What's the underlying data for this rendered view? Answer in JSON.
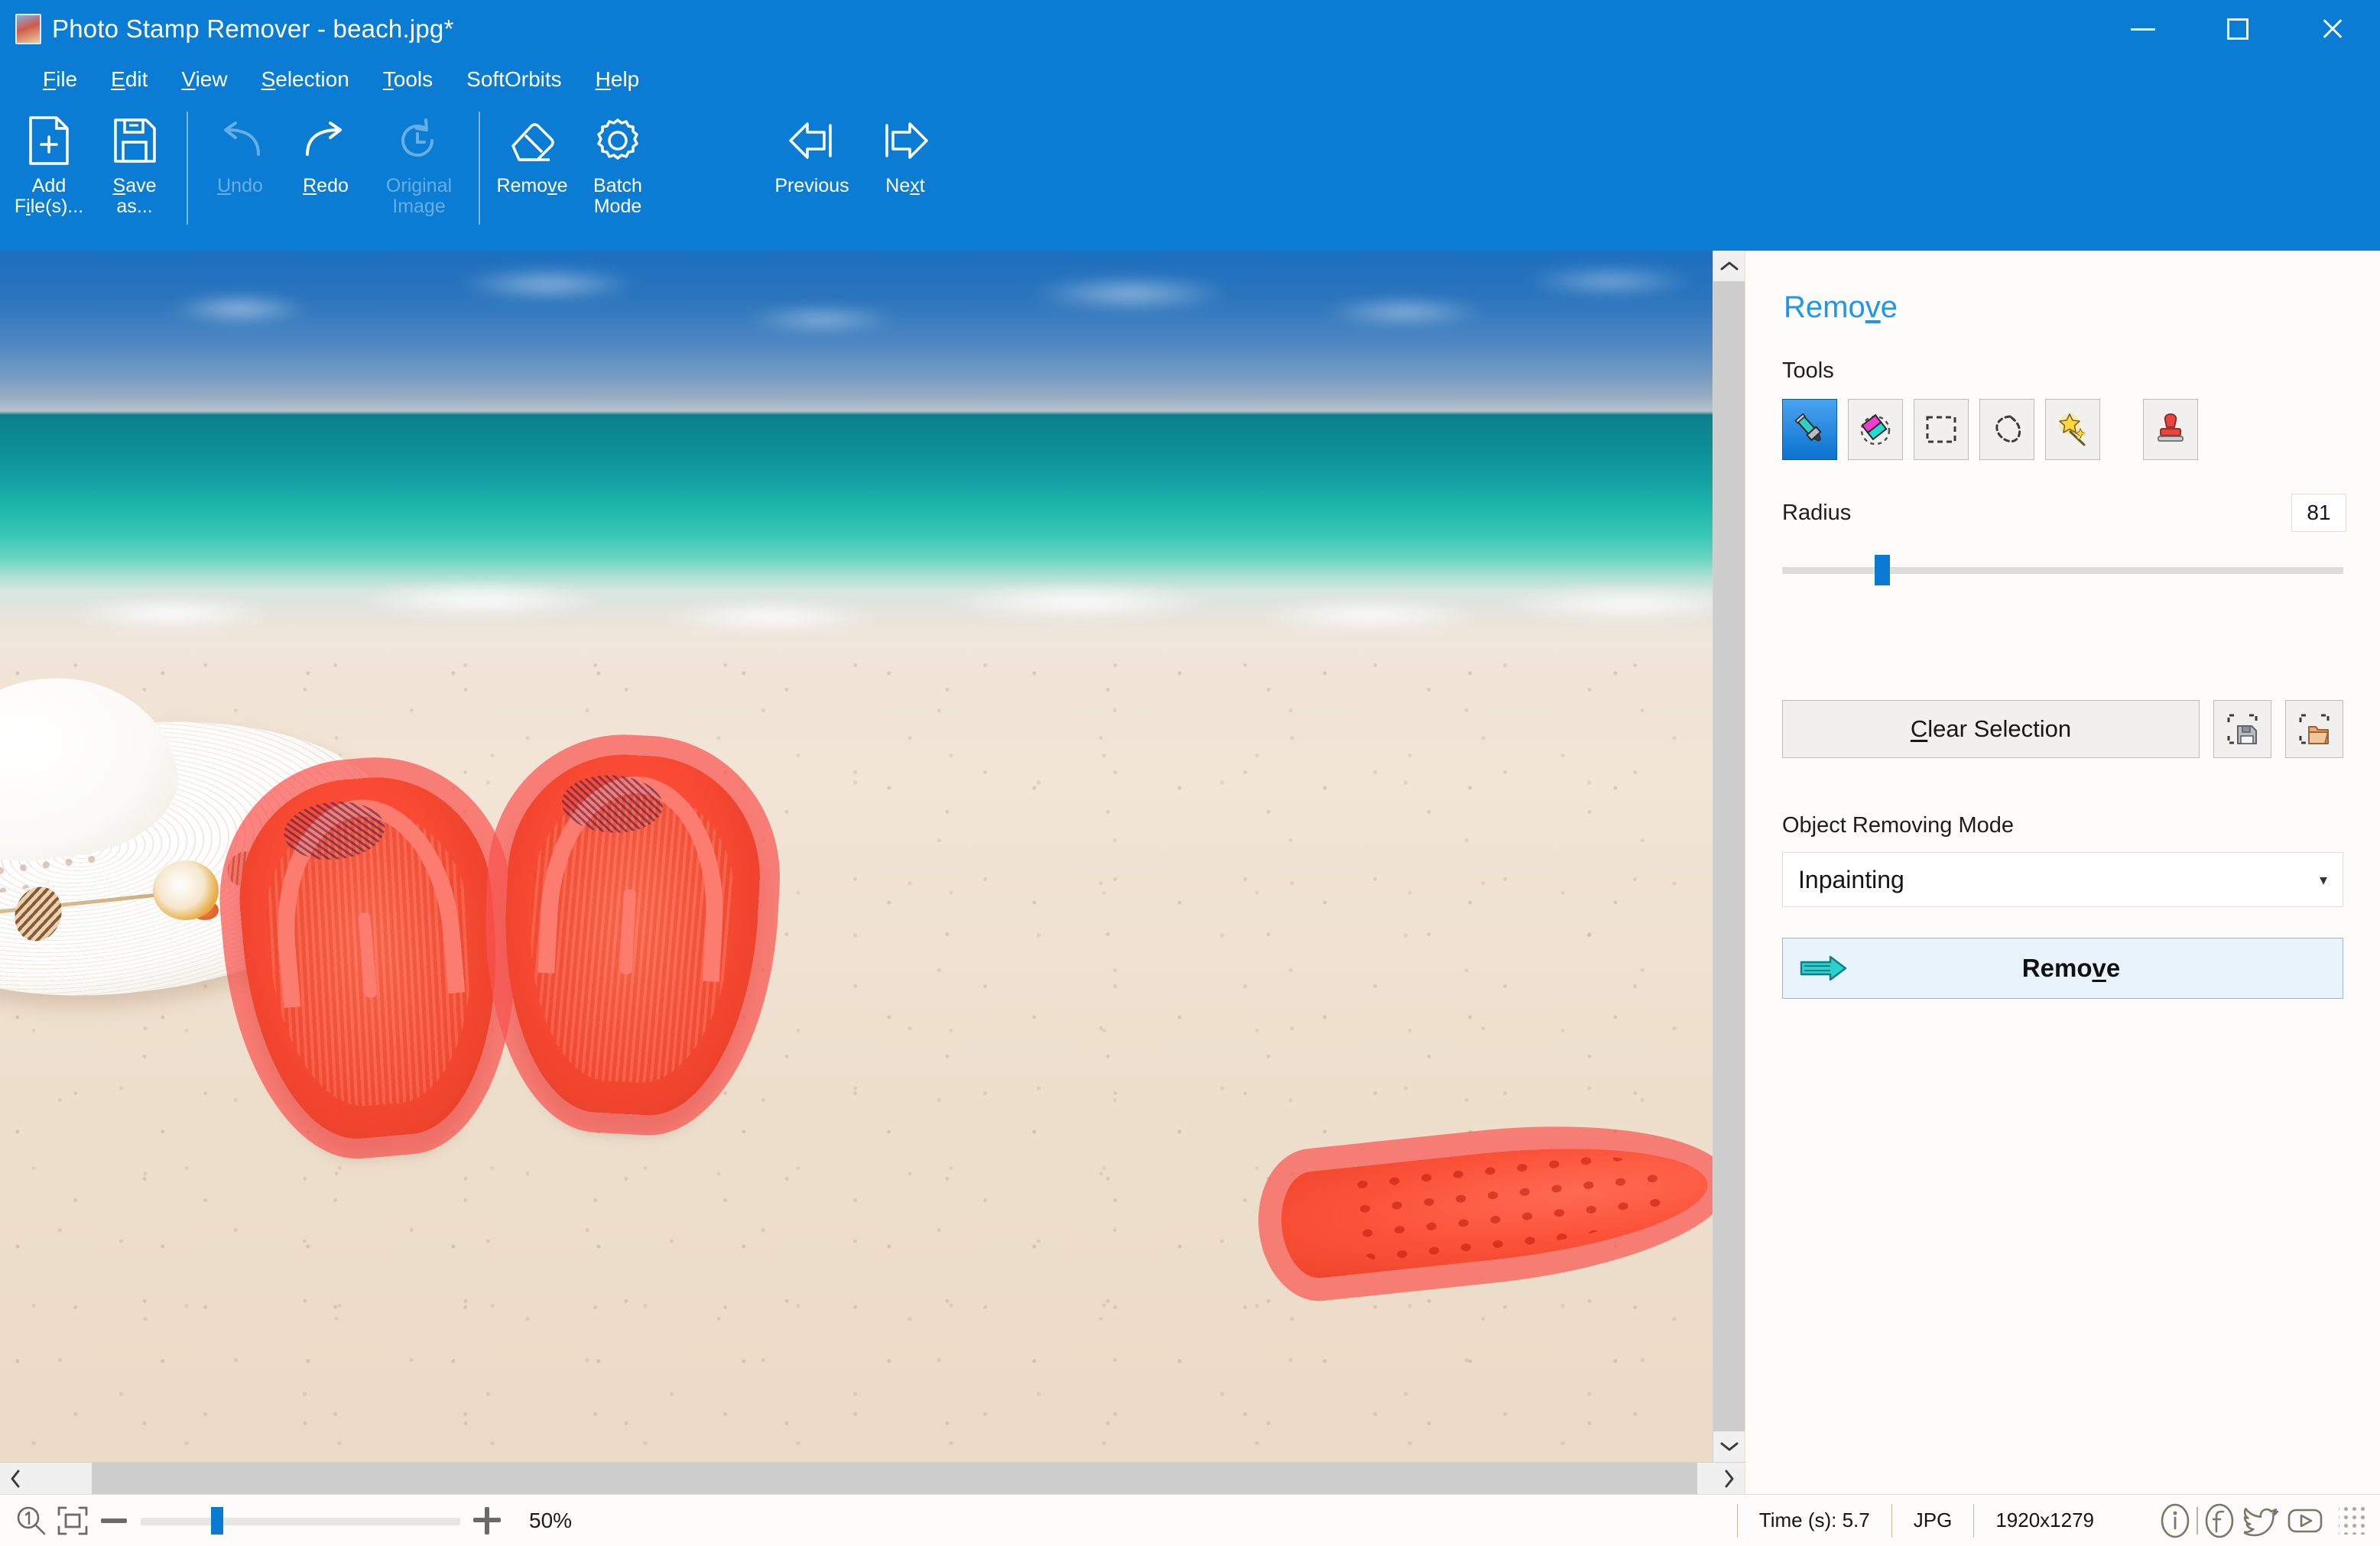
{
  "window": {
    "title": "Photo Stamp Remover - beach.jpg*",
    "app_icon": "photo-thumbnail-icon",
    "controls": {
      "minimize": "minimize-icon",
      "maximize": "maximize-icon",
      "close": "close-icon"
    },
    "titlebar_color": "#0A7CD4"
  },
  "menubar": {
    "items": [
      {
        "label": "File",
        "accel": "F"
      },
      {
        "label": "Edit",
        "accel": "E"
      },
      {
        "label": "View",
        "accel": "V"
      },
      {
        "label": "Selection",
        "accel": "S"
      },
      {
        "label": "Tools",
        "accel": "T"
      },
      {
        "label": "SoftOrbits",
        "accel": ""
      },
      {
        "label": "Help",
        "accel": "H"
      }
    ]
  },
  "toolbar": {
    "buttons": [
      {
        "label": "Add\nFile(s)...",
        "icon": "add-file-icon",
        "enabled": true,
        "accel": "l"
      },
      {
        "label": "Save\nas...",
        "icon": "save-as-icon",
        "enabled": true,
        "accel": "S"
      },
      {
        "label": "Undo",
        "icon": "undo-icon",
        "enabled": false,
        "accel": "U"
      },
      {
        "label": "Redo",
        "icon": "redo-icon",
        "enabled": true,
        "accel": "R"
      },
      {
        "label": "Original\nImage",
        "icon": "original-image-icon",
        "enabled": false,
        "accel": ""
      },
      {
        "label": "Remove",
        "icon": "eraser-icon",
        "enabled": true,
        "accel": "v"
      },
      {
        "label": "Batch\nMode",
        "icon": "gear-icon",
        "enabled": true,
        "accel": ""
      },
      {
        "label": "Previous",
        "icon": "arrow-left-icon",
        "enabled": true,
        "accel": ""
      },
      {
        "label": "Next",
        "icon": "arrow-right-icon",
        "enabled": true,
        "accel": "x"
      }
    ]
  },
  "canvas": {
    "image_description": "beach scene with white straw sun hat, pair of coral flip-flops and a spotted cone shell on sand",
    "selection_overlay_color": "#FA5450",
    "vertical_scrollbar": {
      "up": "chevron-up-icon",
      "down": "chevron-down-icon"
    },
    "horizontal_scrollbar": {
      "left": "chevron-left-icon",
      "right": "chevron-right-icon"
    }
  },
  "panel": {
    "title": "Remove",
    "title_accel": "v",
    "tools_label": "Tools",
    "tools": [
      {
        "name": "marker-tool",
        "icon": "marker-icon",
        "selected": true
      },
      {
        "name": "eraser-tool",
        "icon": "eraser-tool-icon",
        "selected": false
      },
      {
        "name": "rectangle-select-tool",
        "icon": "rectangle-select-icon",
        "selected": false
      },
      {
        "name": "lasso-tool",
        "icon": "lasso-icon",
        "selected": false
      },
      {
        "name": "magic-wand-tool",
        "icon": "magic-wand-icon",
        "selected": false
      },
      {
        "name": "stamp-tool",
        "icon": "stamp-icon",
        "selected": false
      }
    ],
    "radius_label": "Radius",
    "radius_value": "81",
    "radius_slider_percent": 17,
    "clear_selection_label": "Clear Selection",
    "clear_selection_accel": "C",
    "save_selection_icon": "save-selection-icon",
    "load_selection_icon": "load-selection-icon",
    "mode_label": "Object Removing Mode",
    "mode_value": "Inpainting",
    "mode_options": [
      "Inpainting"
    ],
    "remove_button_label": "Remove",
    "remove_button_accel": "v",
    "remove_button_icon": "arrow-right-teal-icon",
    "accent_color": "#2196E8"
  },
  "statusbar": {
    "zoom_actual_icon": "zoom-actual-size-icon",
    "fit_window_icon": "fit-to-window-icon",
    "zoom_out_icon": "minus-icon",
    "zoom_in_icon": "plus-icon",
    "zoom_percent": "50%",
    "zoom_slider_percent": 22,
    "time_label": "Time (s): 5.7",
    "format_label": "JPG",
    "dimensions_label": "1920x1279",
    "social": [
      {
        "name": "info-icon"
      },
      {
        "name": "facebook-icon"
      },
      {
        "name": "twitter-icon"
      },
      {
        "name": "youtube-icon"
      }
    ],
    "resize_grip_icon": "resize-grip-icon"
  }
}
